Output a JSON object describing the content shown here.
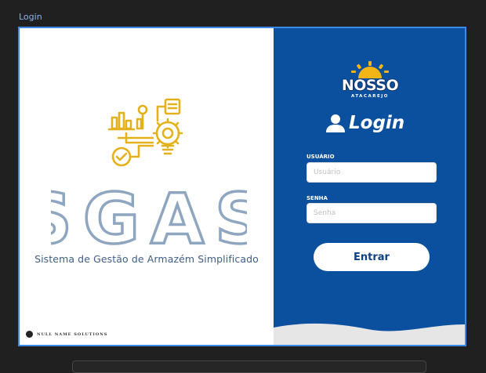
{
  "window": {
    "title": "Login"
  },
  "brand": {
    "title": "SGAS",
    "subtitle": "Sistema de Gestão de Armazém Simplificado",
    "credit": "NULL NAME SOLUTIONS"
  },
  "logo": {
    "main": "NOSSO",
    "sub": "ATACAREJO"
  },
  "login": {
    "heading": "Login",
    "user_label": "USUÁRIO",
    "user_placeholder": "Usuário",
    "password_label": "SENHA",
    "password_placeholder": "Senha",
    "submit_label": "Entrar"
  },
  "colors": {
    "accent": "#0b4f9f",
    "illustration": "#e3b21a",
    "title": "#8fa6c0",
    "frame_border": "#3d8be6"
  },
  "icons": [
    "chart-gear-lightbulb-icon",
    "user-icon",
    "sun-icon"
  ]
}
